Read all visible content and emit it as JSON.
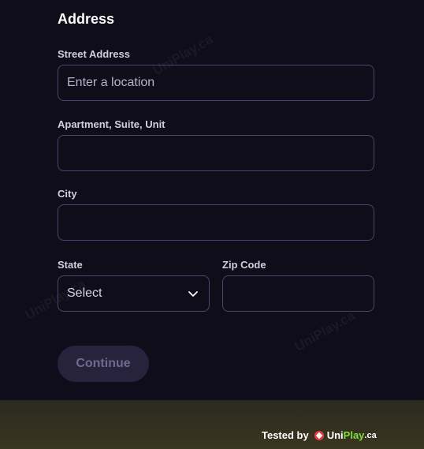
{
  "section_title": "Address",
  "fields": {
    "street": {
      "label": "Street Address",
      "placeholder": "Enter a location",
      "value": ""
    },
    "apartment": {
      "label": "Apartment, Suite, Unit",
      "value": ""
    },
    "city": {
      "label": "City",
      "value": ""
    },
    "state": {
      "label": "State",
      "selected": "Select"
    },
    "zip": {
      "label": "Zip Code",
      "value": ""
    }
  },
  "continue_label": "Continue",
  "watermark": "UniPlay.ca",
  "footer": {
    "tested_by": "Tested by",
    "brand_uni": "Uni",
    "brand_play": "Play",
    "brand_tld": ".ca"
  },
  "colors": {
    "background": "#0f0d1a",
    "field_border": "#4a4470",
    "button_bg": "#27233c",
    "brand_green": "#7ee03a"
  }
}
